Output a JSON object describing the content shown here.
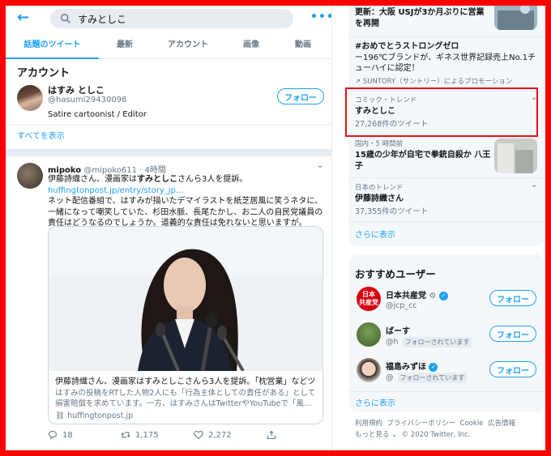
{
  "search": {
    "query": "すみとしこ"
  },
  "tabs": [
    {
      "label": "話題のツイート"
    },
    {
      "label": "最新"
    },
    {
      "label": "アカウント"
    },
    {
      "label": "画像"
    },
    {
      "label": "動画"
    }
  ],
  "accounts": {
    "heading": "アカウント",
    "name": "はすみ としこ",
    "handle": "@hasumi29430098",
    "bio": "Satire cartoonist / Editor",
    "follow_label": "フォロー",
    "show_all": "すべてを表示"
  },
  "tweet": {
    "author": "mipoko",
    "handle": "@mipoko611",
    "time": "4時間",
    "line1_pre": "伊藤詩織さん、漫画家は",
    "line1_bold": "すみとしこ",
    "line1_post": "さんら3人を提訴。",
    "link": "huffingtonpost.jp/entry/story_jp…",
    "body": "ネット配信番組で、はすみが描いたデマイラストを紙芝居風に笑うネタに、一緒になって嘲笑していた、杉田水脈、長尾たかし、お二人の自民党議員の責任はどうなるのでしょうか。道義的な責任は免れないと思いますが。",
    "card": {
      "title": "伊藤詩織さん、漫画家はすみとしこさんら3人を提訴。「枕営業」などツイ…",
      "desc": "はすみの投稿をRTした人物2人にも「行為主体としての責任がある」として損害賠償を求めています。一方、はすみさんはTwitterやYouTubeで「風…",
      "domain": "huffingtonpost.jp"
    },
    "replies": "18",
    "retweets": "1,175",
    "likes": "2,272"
  },
  "trends": {
    "top_title": "更新：大阪 USJが3か月ぶりに営業",
    "top_title2": "を再開",
    "promo_tag": "#おめでとうストロングゼロ",
    "promo_text": "ー196℃ブランドが、ギネス世界記録売上No.1チューハイに認定！",
    "promo_by": "SUNTORY（サントリー）によるプロモーション",
    "t1_meta": "コミック・トレンド",
    "t1_title": "すみとしこ",
    "t1_count": "27,268件のツイート",
    "t2_meta": "国内・5 時間前",
    "t2_title": "15歳の少年が自宅で拳銃自殺か 八王子",
    "t3_meta": "日本のトレンド",
    "t3_title": "伊藤詩織さん",
    "t3_count": "37,355件のツイート",
    "show_more": "さらに表示"
  },
  "who_to_follow": {
    "title": "おすすめユーザー",
    "follows_you": "フォローされています",
    "follow_label": "フォロー",
    "users": [
      {
        "name": "日本共産党",
        "handle": "@jcp_cc",
        "avatar_text": "日本共産党"
      },
      {
        "name": "ばーす",
        "handle": "@h"
      },
      {
        "name": "福島みずほ",
        "handle": "@"
      }
    ],
    "show_more": "さらに表示"
  },
  "footer": {
    "line1": [
      "利用規約",
      "プライバシーポリシー",
      "Cookie",
      "広告情報"
    ],
    "more": "もっと見る ⌄",
    "copyright": "© 2020 Twitter, Inc."
  },
  "colors": {
    "accent": "#1da1f2",
    "highlight": "#e0121a",
    "frame": "#ff0000",
    "jcp_red": "#d7000f"
  }
}
